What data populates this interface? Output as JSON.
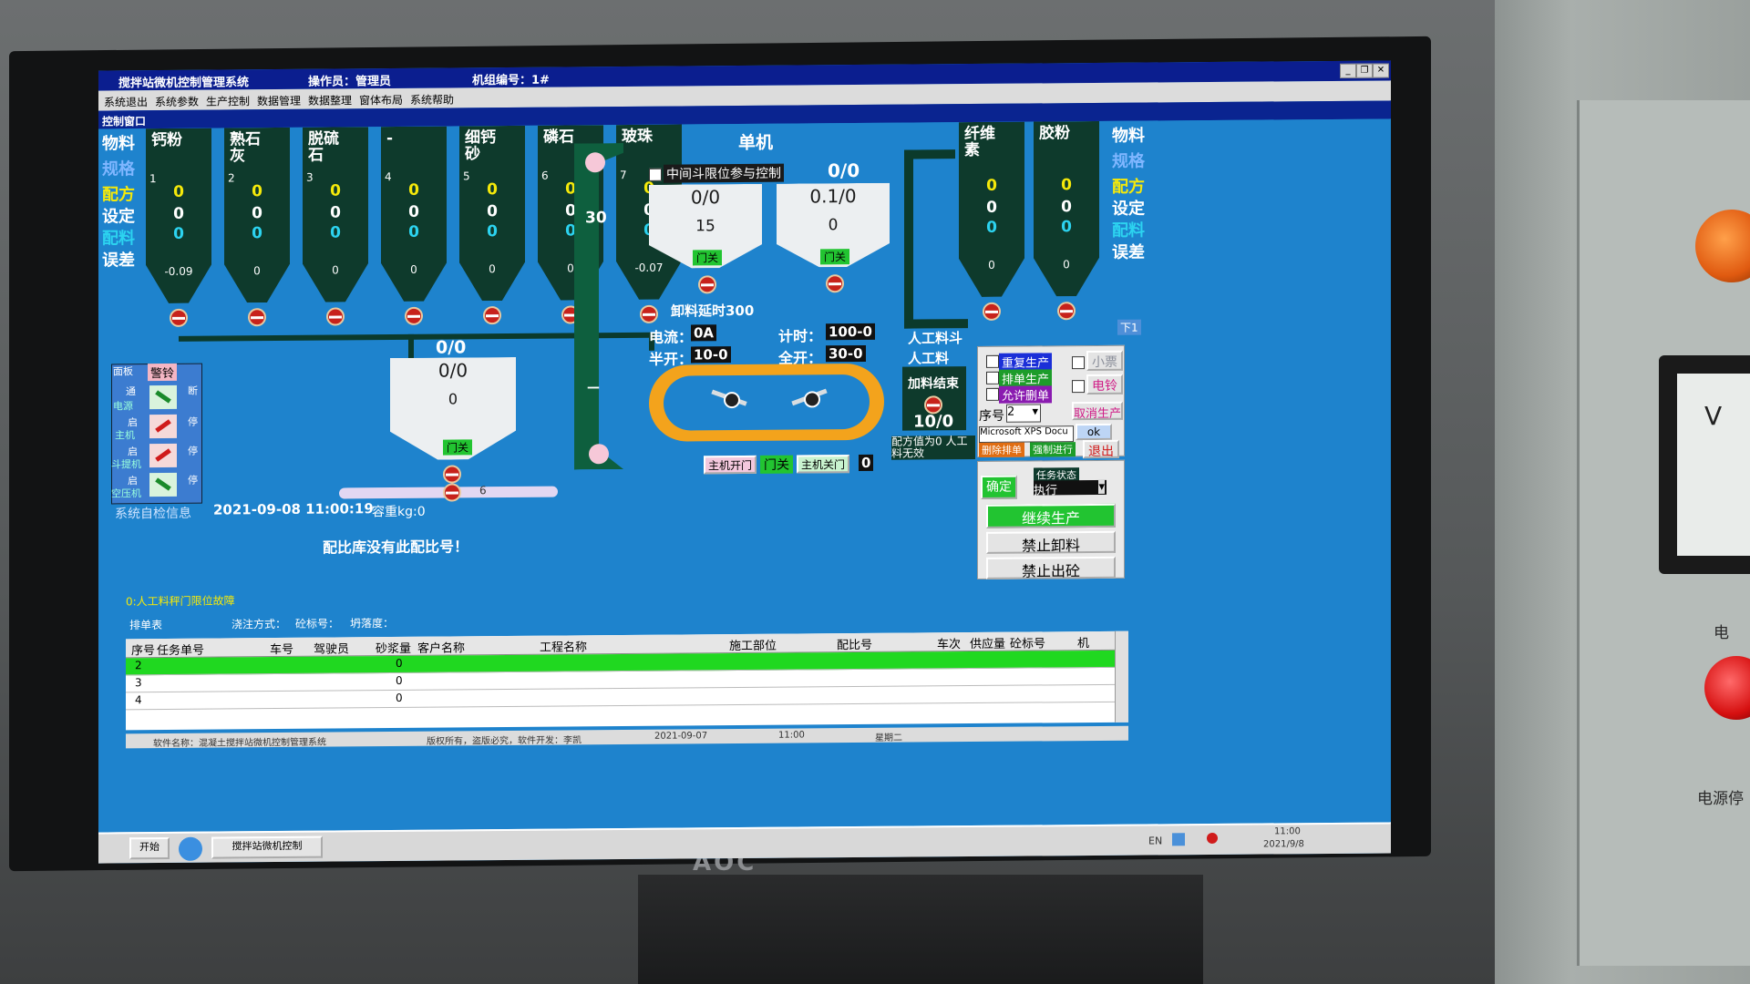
{
  "window": {
    "title": "搅拌站微机控制管理系统",
    "operator": "操作员：管理员",
    "machine_no": "机组编号：1#"
  },
  "menu": [
    "系统退出",
    "系统参数",
    "生产控制",
    "数据管理",
    "数据整理",
    "窗体布局",
    "系统帮助"
  ],
  "control_window_title": "控制窗口",
  "row_labels_left": [
    "物料",
    "规格",
    "配方",
    "设定",
    "配料",
    "误差"
  ],
  "row_labels_right": [
    "物料",
    "规格",
    "配方",
    "设定",
    "配料",
    "误差"
  ],
  "silos": [
    {
      "name": "钙粉",
      "idx": "1",
      "recipe": "0",
      "set": "0",
      "batch": "0",
      "err": "-0.09"
    },
    {
      "name": "熟石灰",
      "idx": "2",
      "recipe": "0",
      "set": "0",
      "batch": "0",
      "err": "0"
    },
    {
      "name": "脱硫石",
      "idx": "3",
      "recipe": "0",
      "set": "0",
      "batch": "0",
      "err": "0"
    },
    {
      "name": "-",
      "idx": "4",
      "recipe": "0",
      "set": "0",
      "batch": "0",
      "err": "0"
    },
    {
      "name": "细钙砂",
      "idx": "5",
      "recipe": "0",
      "set": "0",
      "batch": "0",
      "err": "0"
    },
    {
      "name": "磷石",
      "idx": "6",
      "recipe": "0",
      "set": "0",
      "batch": "0",
      "err": "0"
    },
    {
      "name": "玻珠",
      "idx": "7",
      "recipe": "0",
      "set": "0",
      "batch": "0",
      "err": "-0.07"
    }
  ],
  "right_silos": [
    {
      "name": "纤维素",
      "recipe": "0",
      "set": "0",
      "batch": "0",
      "err": "0"
    },
    {
      "name": "胶粉",
      "recipe": "0",
      "set": "0",
      "batch": "0",
      "err": "0"
    }
  ],
  "single_machine": "单机",
  "mid_hopper_ctrl": "中间斗限位参与控制",
  "hopper_a": {
    "top": "0/0",
    "v1": "0/0",
    "v2": "15",
    "door": "门关"
  },
  "hopper_b": {
    "top": "0/0",
    "v1": "0.1/0",
    "v2": "0",
    "door": "门关"
  },
  "discharge_delay": "卸料延时300",
  "current_label": "电流：",
  "current_val": "0A",
  "timer_label": "计时：",
  "timer_val": "100-0",
  "half_open_label": "半开：",
  "half_open_val": "10-0",
  "full_open_label": "全开：",
  "full_open_val": "30-0",
  "elevator_val": "30",
  "elevator_dash": "—",
  "scale_hopper": {
    "top": "0/0",
    "v1": "0/0",
    "v2": "0",
    "door": "门关",
    "belt": "6"
  },
  "manual": {
    "title1": "人工料斗",
    "title2": "人工料",
    "done": "加料结束",
    "ratio": "10/0",
    "invalid": "配方值为0 人工料无效"
  },
  "mixer_buttons": {
    "open": "主机开门",
    "door": "门关",
    "close": "主机关门",
    "count": "0"
  },
  "left_ctrl": {
    "header1": "面板",
    "header2": "警铃",
    "row1": "通",
    "row1r": "断",
    "r2a": "启",
    "r2b": "主机",
    "r2c": "停",
    "r3a": "启",
    "r3b": "斗提机",
    "r3c": "停",
    "r4a": "启",
    "r4b": "空压机",
    "r4c": "停",
    "side": "电源"
  },
  "self_check_label": "系统自检信息",
  "datetime": "2021-09-08 11:00:19",
  "capacity": "容重kg:0",
  "error_msg": "配比库没有此配比号！",
  "fault_msg": "0:人工料秤门限位故障",
  "schedule_label": "排单表",
  "pour_label": "浇注方式：",
  "grade_label": "砼标号：",
  "slump_label": "坍落度：",
  "options": [
    {
      "label": "重复生产",
      "bg": "#1b2fd8"
    },
    {
      "label": "排单生产",
      "bg": "#1d9c2a"
    },
    {
      "label": "允许删单",
      "bg": "#8a1bb0"
    }
  ],
  "side_toggles": [
    {
      "label": "小票"
    },
    {
      "label": "电铃"
    }
  ],
  "seq_label": "序号",
  "seq_val": "2",
  "cancel_prod": "取消生产",
  "printer": "Microsoft XPS Docu",
  "ok": "ok",
  "delete_sched": "删除排单",
  "force_run": "强制进行",
  "exit": "退出",
  "confirm": "确定",
  "task_status_label": "任务状态",
  "task_status": "执行",
  "continue_prod": "继续生产",
  "no_unload": "禁止卸料",
  "no_concrete": "禁止出砼",
  "down_btn": "下1",
  "table": {
    "headers": [
      "序号",
      "任务单号",
      "车号",
      "驾驶员",
      "砂浆量",
      "客户名称",
      "工程名称",
      "施工部位",
      "配比号",
      "车次",
      "供应量",
      "砼标号",
      "机"
    ],
    "rows": [
      {
        "seq": "2",
        "qty": "0",
        "highlight": true
      },
      {
        "seq": "3",
        "qty": "0",
        "highlight": false
      },
      {
        "seq": "4",
        "qty": "0",
        "highlight": false
      }
    ]
  },
  "status_bar": {
    "software": "软件名称：混凝土搅拌站微机控制管理系统",
    "copyright": "版权所有，盗版必究，软件开发：李凯",
    "date": "2021-09-07",
    "time": "11:00",
    "weekday": "星期二"
  },
  "taskbar": {
    "start": "开始",
    "app": "搅拌站微机控制",
    "lang": "EN",
    "clock_time": "11:00",
    "clock_date": "2021/9/8"
  },
  "monitor_brand": "AOC",
  "panel_labels": {
    "power": "电",
    "power_stop": "电源停",
    "v": "V"
  },
  "colors": {
    "screen_bg": "#1e83cd",
    "silo": "#0e3a2c",
    "recipe": "#f5e90a",
    "batch": "#2cd3f0",
    "highlight_row": "#20d820"
  }
}
